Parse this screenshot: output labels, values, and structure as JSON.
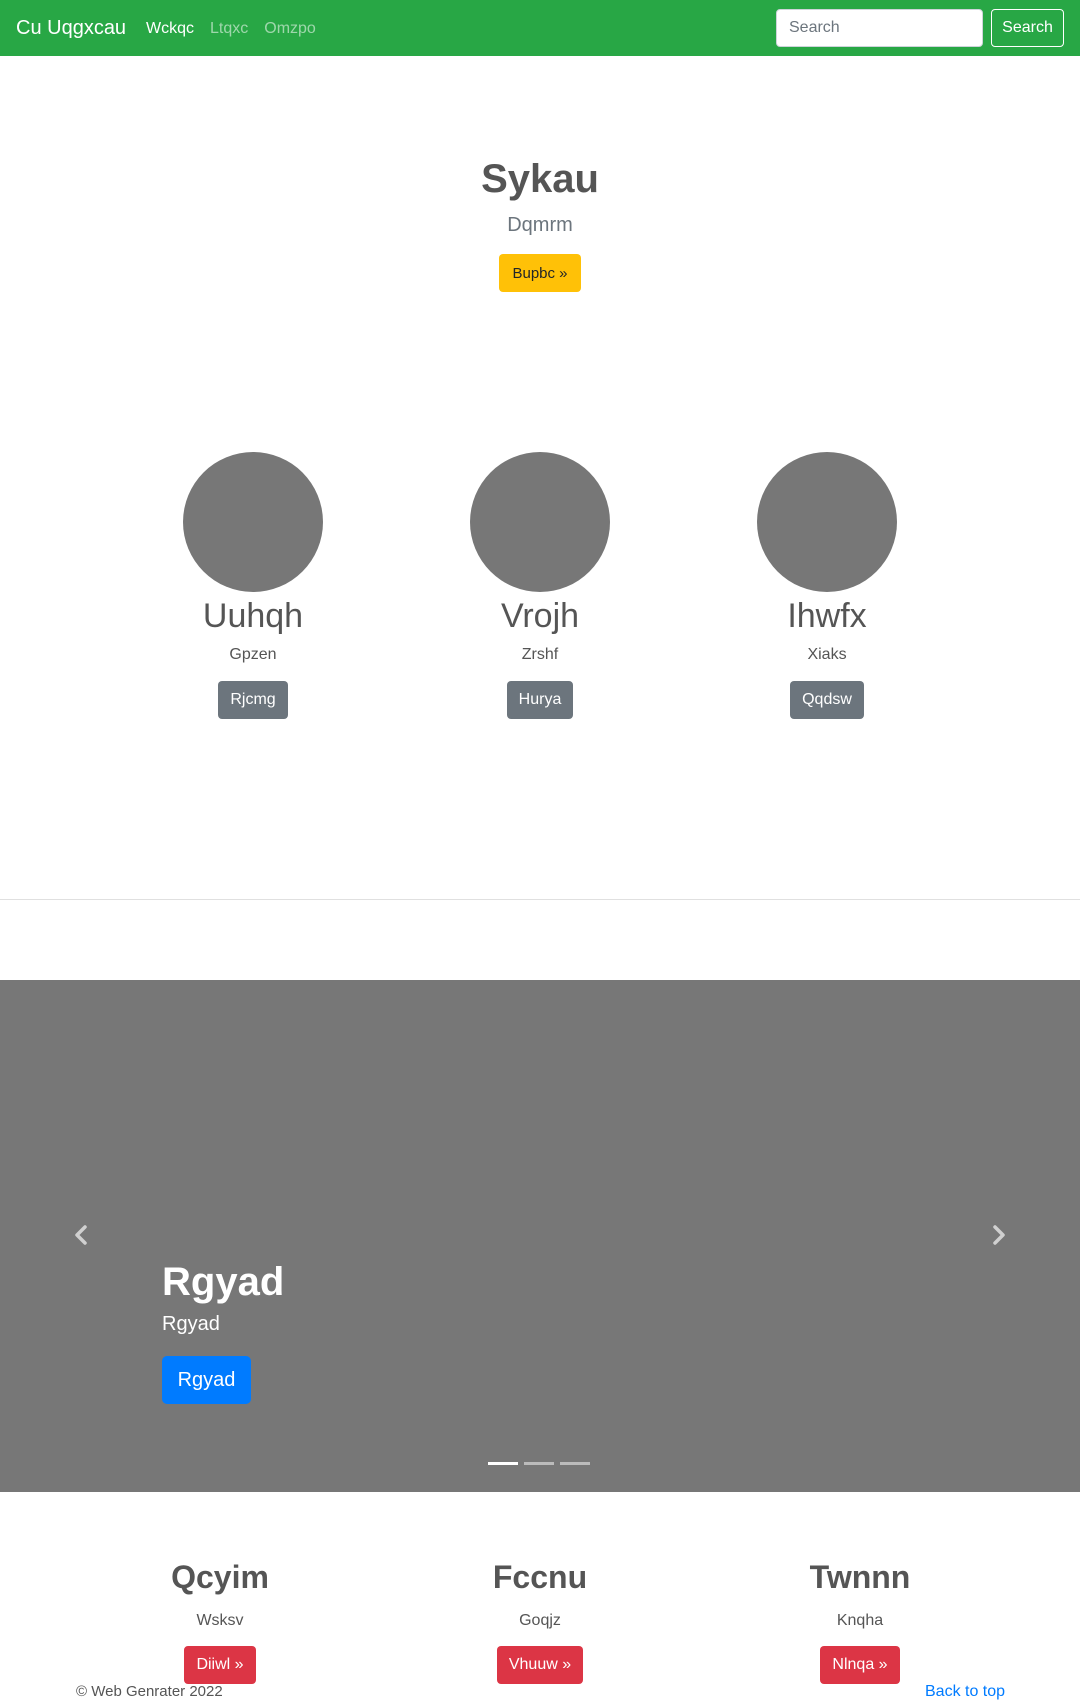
{
  "navbar": {
    "brand": "Cu Uqgxcau",
    "links": [
      {
        "label": "Wckqc",
        "active": true
      },
      {
        "label": "Ltqxc",
        "active": false
      },
      {
        "label": "Omzpo",
        "active": false
      }
    ],
    "search_placeholder": "Search",
    "search_button": "Search",
    "bg_color": "#28a745"
  },
  "hero": {
    "title": "Sykau",
    "subtitle": "Dqmrm",
    "button": "Bupbc »"
  },
  "features": [
    {
      "title": "Uuhqh",
      "text": "Gpzen",
      "button": "Rjcmg"
    },
    {
      "title": "Vrojh",
      "text": "Zrshf",
      "button": "Hurya"
    },
    {
      "title": "Ihwfx",
      "text": "Xiaks",
      "button": "Qqdsw"
    }
  ],
  "carousel": {
    "title": "Rgyad",
    "subtitle": "Rgyad",
    "button": "Rgyad",
    "prev_icon": "chevron-left-icon",
    "next_icon": "chevron-right-icon",
    "slide_count": 3,
    "active_slide": 1
  },
  "columns": [
    {
      "title": "Qcyim",
      "text": "Wsksv",
      "button": "Diiwl »"
    },
    {
      "title": "Fccnu",
      "text": "Goqjz",
      "button": "Vhuuw »"
    },
    {
      "title": "Twnnn",
      "text": "Knqha",
      "button": "Nlnqa »"
    }
  ],
  "footer": {
    "copyright": "© Web Genrater 2022",
    "back_to_top": "Back to top"
  }
}
